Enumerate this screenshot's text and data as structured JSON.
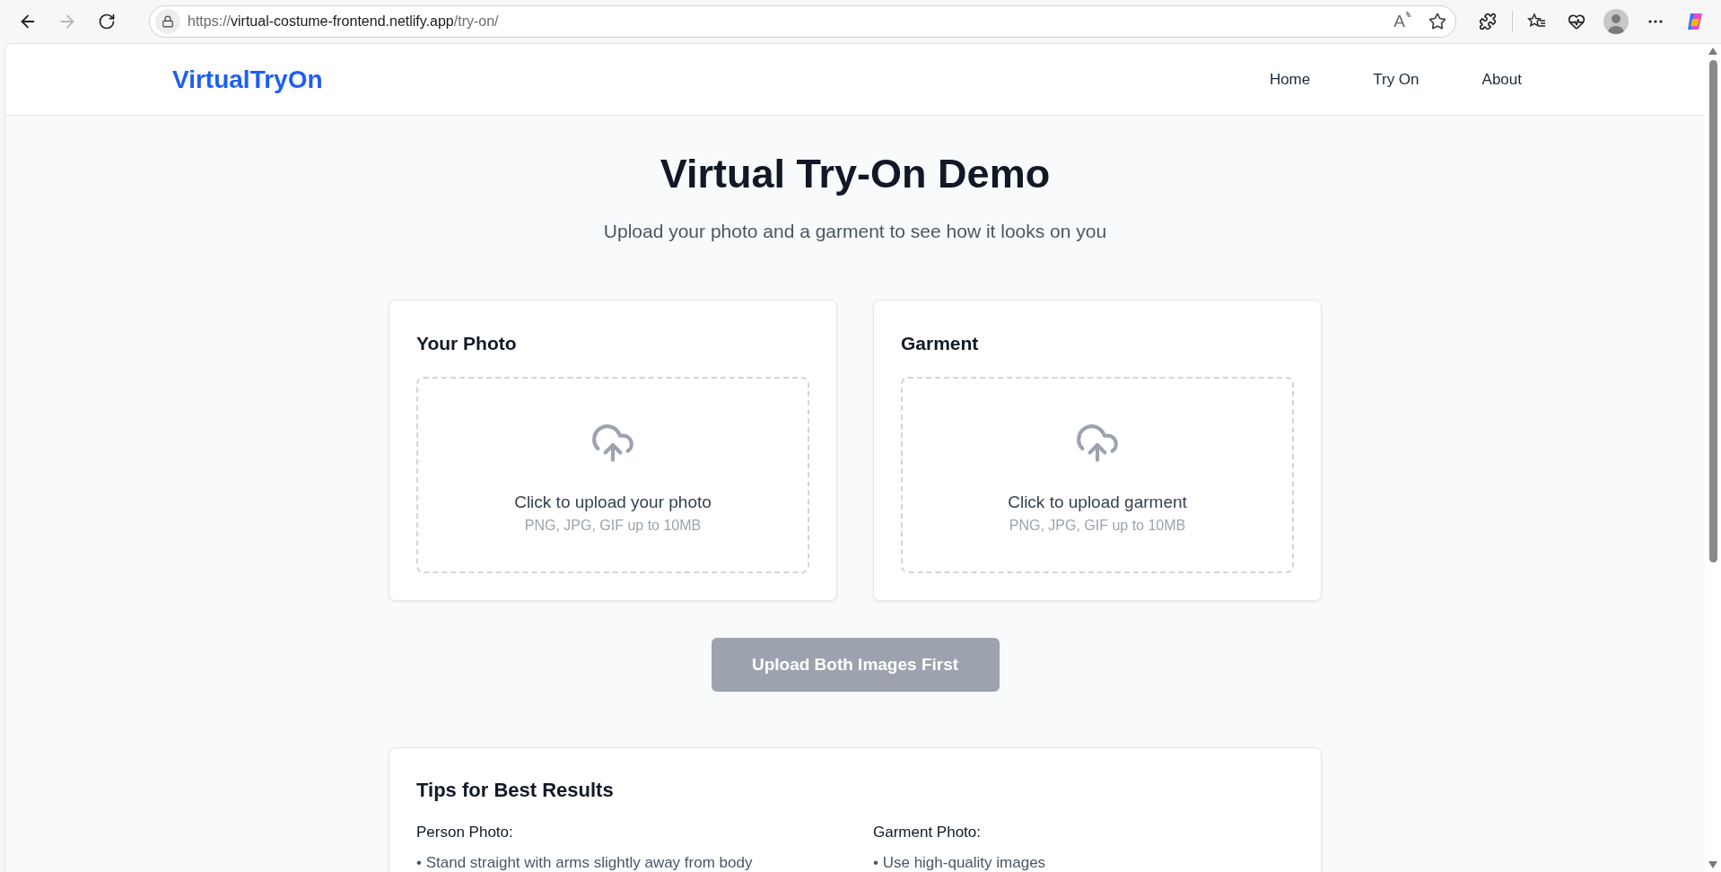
{
  "browser": {
    "url": {
      "scheme": "https://",
      "host": "virtual-costume-frontend.netlify.app",
      "path": "/try-on/"
    },
    "read_aloud_glyph": "A"
  },
  "header": {
    "logo": "VirtualTryOn",
    "nav": [
      {
        "label": "Home",
        "selected": false
      },
      {
        "label": "Try On",
        "selected": false
      },
      {
        "label": "About",
        "selected": false
      }
    ]
  },
  "title": "Virtual Try-On Demo",
  "subtitle": "Upload your photo and a garment to see how it looks on you",
  "uploads": [
    {
      "title": "Your Photo",
      "prompt": "Click to upload your photo",
      "hint": "PNG, JPG, GIF up to 10MB"
    },
    {
      "title": "Garment",
      "prompt": "Click to upload garment",
      "hint": "PNG, JPG, GIF up to 10MB"
    }
  ],
  "submit": {
    "label": "Upload Both Images First",
    "disabled": true
  },
  "tips": {
    "title": "Tips for Best Results",
    "columns": [
      {
        "heading": "Person Photo:",
        "items": [
          "• Stand straight with arms slightly away from body"
        ]
      },
      {
        "heading": "Garment Photo:",
        "items": [
          "• Use high-quality images"
        ]
      }
    ]
  }
}
